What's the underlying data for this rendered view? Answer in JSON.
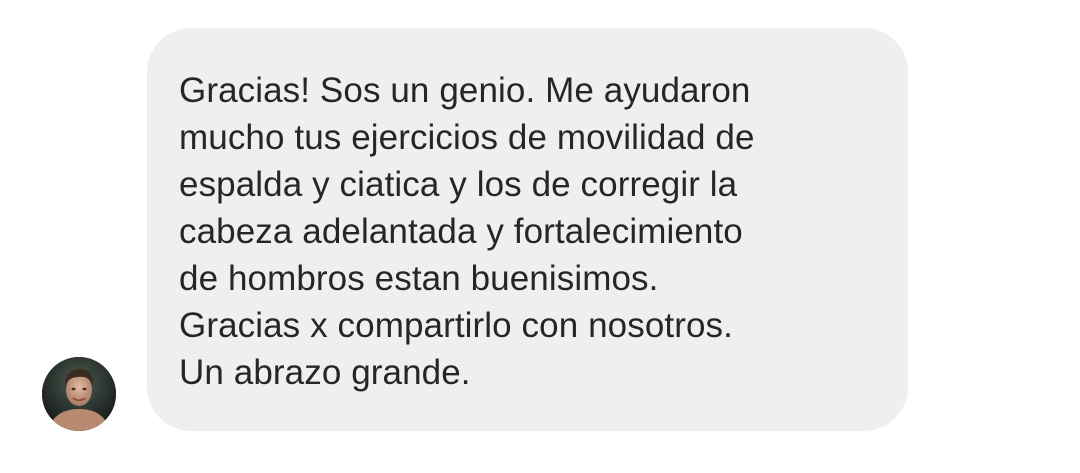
{
  "conversation": {
    "sender": {
      "avatar_icon": "user-photo-avatar"
    },
    "message": {
      "lines": [
        "Gracias! Sos un genio. Me ayudaron",
        "mucho tus ejercicios de movilidad de",
        "espalda y ciatica y los de corregir la",
        "cabeza adelantada y fortalecimiento",
        "de hombros estan buenisimos.",
        "Gracias x compartirlo con nosotros.",
        "Un abrazo grande."
      ]
    }
  },
  "colors": {
    "bubble_background": "#efefef",
    "text": "#262626",
    "page_background": "#ffffff"
  }
}
